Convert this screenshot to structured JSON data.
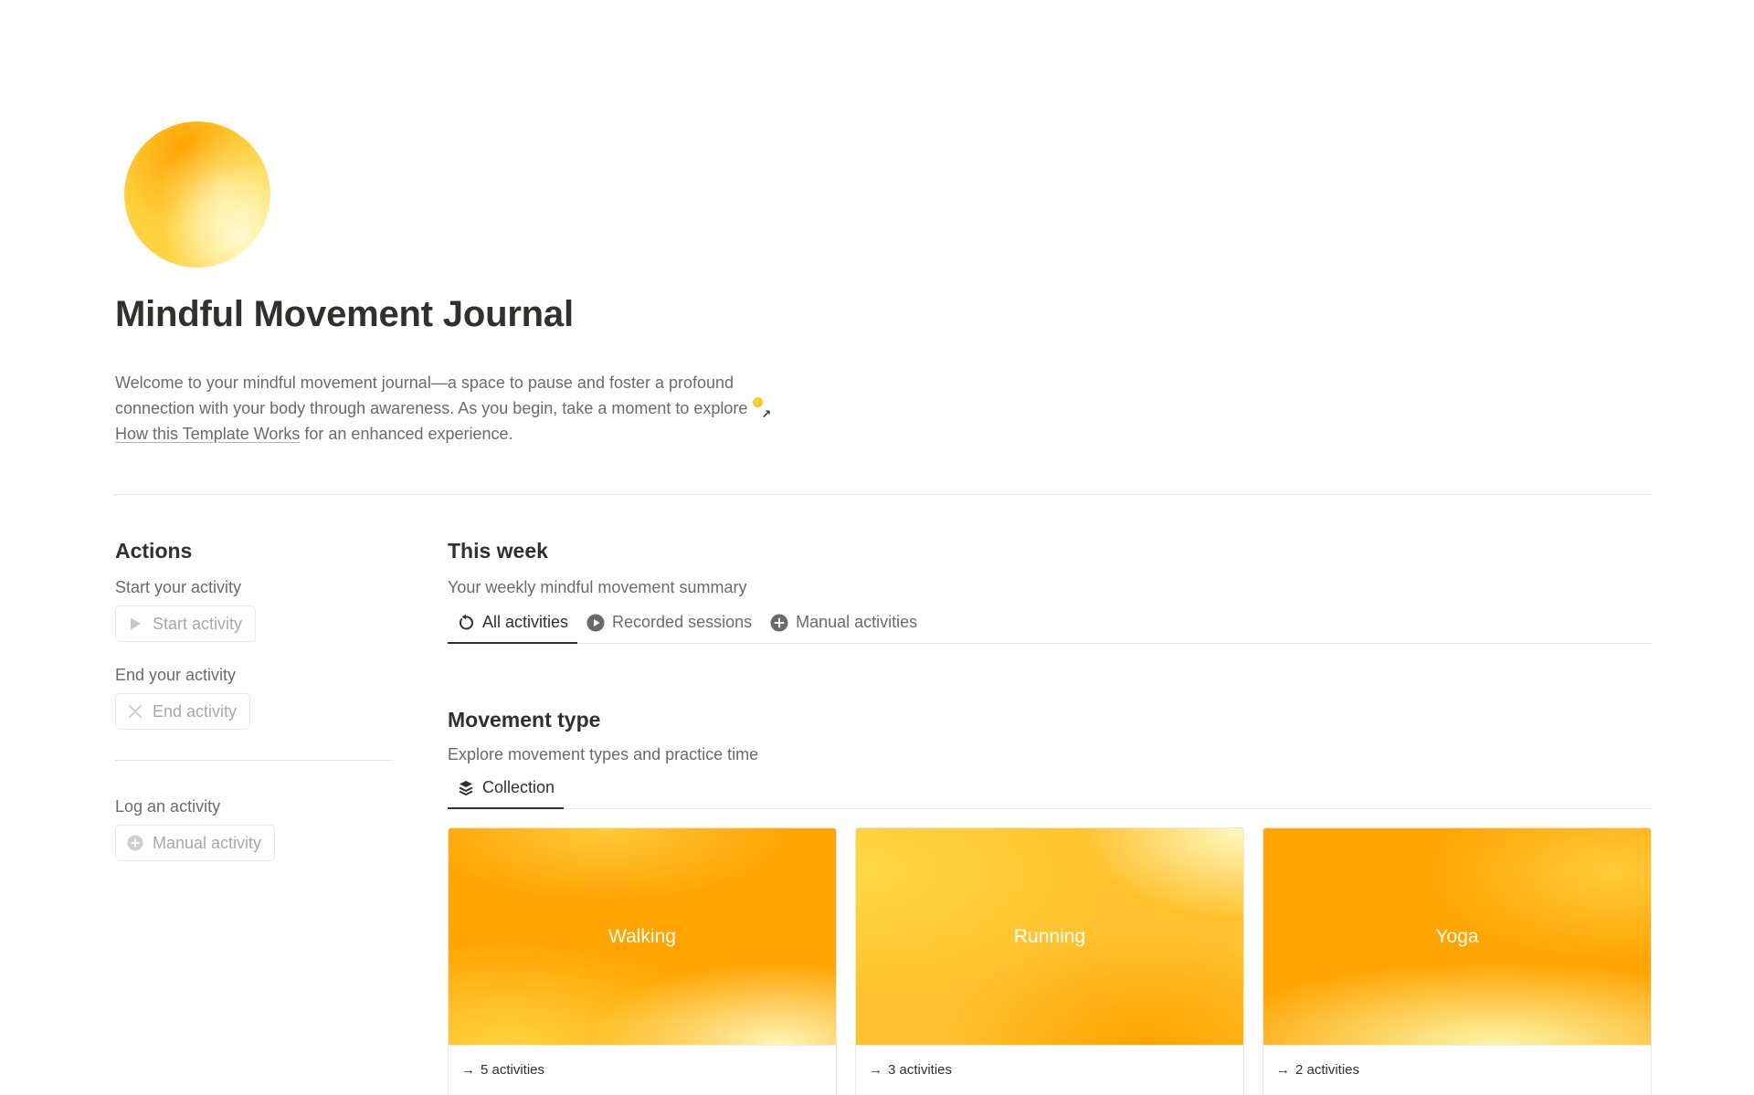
{
  "header": {
    "title": "Mindful Movement Journal",
    "intro_line1": "Welcome to your mindful movement journal—a space to pause and foster a profound",
    "intro_line2": "connection with your body through awareness. As you begin, take a moment to explore",
    "intro_link": "How this Template Works",
    "intro_end": " for an enhanced experience."
  },
  "actions": {
    "heading": "Actions",
    "start_caption": "Start your activity",
    "start_button": "Start activity",
    "end_caption": "End your activity",
    "end_button": "End activity",
    "log_caption": "Log an activity",
    "log_button": "Manual activity"
  },
  "this_week": {
    "heading": "This week",
    "subtitle": "Your weekly mindful movement summary",
    "tabs": [
      {
        "label": "All activities",
        "icon": "refresh-icon",
        "active": true
      },
      {
        "label": "Recorded sessions",
        "icon": "play-circle-icon",
        "active": false
      },
      {
        "label": "Manual activities",
        "icon": "plus-circle-icon",
        "active": false
      }
    ]
  },
  "movement_type": {
    "heading": "Movement type",
    "subtitle": "Explore movement types and practice time",
    "tabs": [
      {
        "label": "Collection",
        "icon": "layers-icon",
        "active": true
      }
    ],
    "cards": [
      {
        "name": "Walking",
        "count": "5 activities"
      },
      {
        "name": "Running",
        "count": "3 activities"
      },
      {
        "name": "Yoga",
        "count": "2 activities"
      }
    ]
  },
  "colors": {
    "accent_orange": "#ffa400",
    "accent_yellow": "#ffd84a",
    "text_primary": "#32302c",
    "text_secondary": "#6b6a66"
  }
}
